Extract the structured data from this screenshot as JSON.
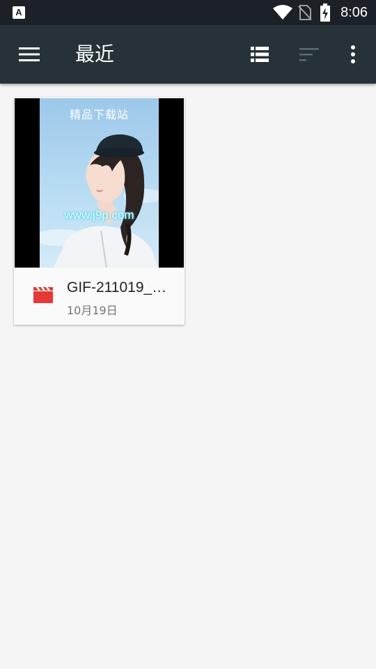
{
  "status_bar": {
    "time": "8:06",
    "app_icon_letter": "A",
    "icons": [
      "wifi-icon",
      "no-sim-icon",
      "battery-charging-icon"
    ]
  },
  "toolbar": {
    "title": "最近",
    "menu_icon": "hamburger-menu-icon",
    "list_view_icon": "list-view-icon",
    "sort_icon": "sort-icon",
    "more_icon": "more-vert-icon"
  },
  "files": [
    {
      "name": "GIF-211019_…",
      "date": "10月19日",
      "type_icon": "video-clapper-icon",
      "thumbnail": {
        "watermark_top": "精品下载站",
        "watermark_url": "www.j9p.com"
      }
    }
  ],
  "colors": {
    "toolbar": "#263238",
    "status_bar": "#1b2127",
    "background": "#f5f5f5",
    "video_icon": "#e53935"
  }
}
